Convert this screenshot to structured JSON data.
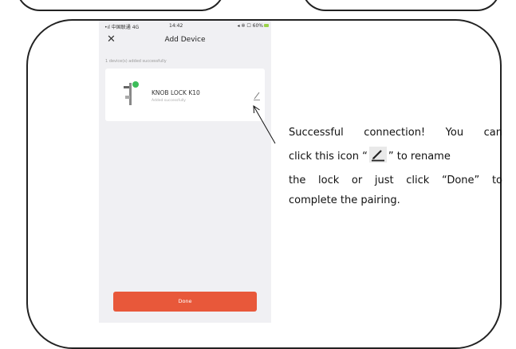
{
  "phone": {
    "status": {
      "carrier": "•ıl 中国联通 4G",
      "time": "14:42",
      "battery": "◂ ✲ ☐ 60%"
    },
    "nav": {
      "close": "✕",
      "title": "Add Device"
    },
    "section_label": "1 device(s) added successfully",
    "device": {
      "name": "KNOB LOCK  K10",
      "status": "Added successfully"
    },
    "done_label": "Done",
    "accent_color": "#e8583a",
    "status_dot_color": "#3dbd5a"
  },
  "annotation": {
    "line1": "Successful connection! You can",
    "line2_before": "click this icon “",
    "line2_after": "” to rename",
    "line3": "the lock or just click  “Done” to",
    "line4": "complete the pairing.",
    "icon": "edit-pencil-icon"
  }
}
